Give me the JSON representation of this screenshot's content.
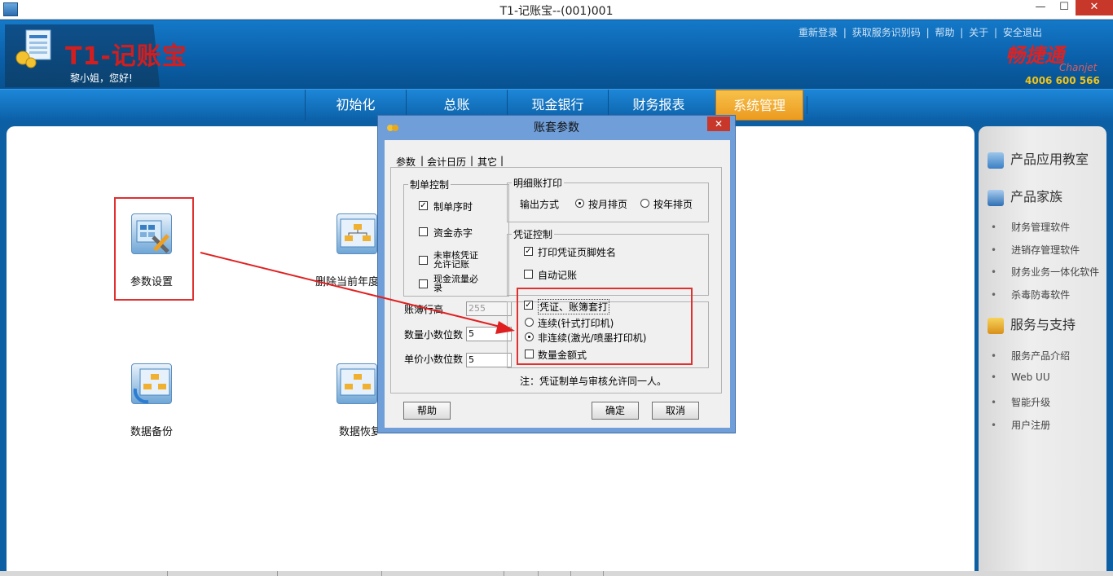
{
  "window": {
    "title": "T1-记账宝--(001)001",
    "min": "—",
    "max": "☐",
    "close": "✕"
  },
  "header": {
    "logo": "T1-记账宝",
    "greeting": "黎小姐，您好!",
    "links": [
      "重新登录",
      "|",
      "获取服务识别码",
      "|",
      "帮助",
      "|",
      "关于",
      "|",
      "安全退出"
    ],
    "brand_name": "畅捷通",
    "brand_en": "Chanjet",
    "brand_phone": "4006 600 566"
  },
  "nav": {
    "init": "初始化",
    "gl": "总账",
    "cash": "现金银行",
    "report": "财务报表",
    "sys": "系统管理"
  },
  "main": {
    "param": "参数设置",
    "delete_year": "删除当前年度",
    "backup": "数据备份",
    "restore": "数据恢复"
  },
  "sidebar": {
    "h1": "产品应用教室",
    "h2": "产品家族",
    "family": [
      "财务管理软件",
      "进销存管理软件",
      "财务业务一体化软件",
      "杀毒防毒软件"
    ],
    "h3": "服务与支持",
    "support": [
      "服务产品介绍",
      "Web UU",
      "智能升级",
      "用户注册"
    ]
  },
  "dialog": {
    "title": "账套参数",
    "close": "✕",
    "tabs": [
      "参数",
      "|",
      "会计日历",
      "|",
      "其它",
      "|"
    ],
    "zd": {
      "title": "制单控制",
      "c1": "制单序时",
      "c2": "资金赤字",
      "c3": "未审核凭证允许记账",
      "c4": "现金流量必录"
    },
    "mx": {
      "title": "明细账打印",
      "label": "输出方式",
      "r1": "按月排页",
      "r2": "按年排页"
    },
    "pz": {
      "title": "凭证控制",
      "c1": "打印凭证页脚姓名",
      "c2": "自动记账"
    },
    "print": {
      "c1": "凭证、账簿套打",
      "r1": "连续(针式打印机)",
      "r2": "非连续(激光/喷墨打印机)",
      "c2": "数量金额式"
    },
    "fields": {
      "row_height": "账簿行高",
      "row_height_val": "255",
      "qty_dec": "数量小数位数",
      "qty_dec_val": "5",
      "price_dec": "单价小数位数",
      "price_dec_val": "5"
    },
    "note": "注：凭证制单与审核允许同一人。",
    "help": "帮助",
    "ok": "确定",
    "cancel": "取消"
  },
  "colors": {
    "accent": "#0d5fa3",
    "highlight": "#e03030",
    "active_tab": "#ec9a1f"
  }
}
